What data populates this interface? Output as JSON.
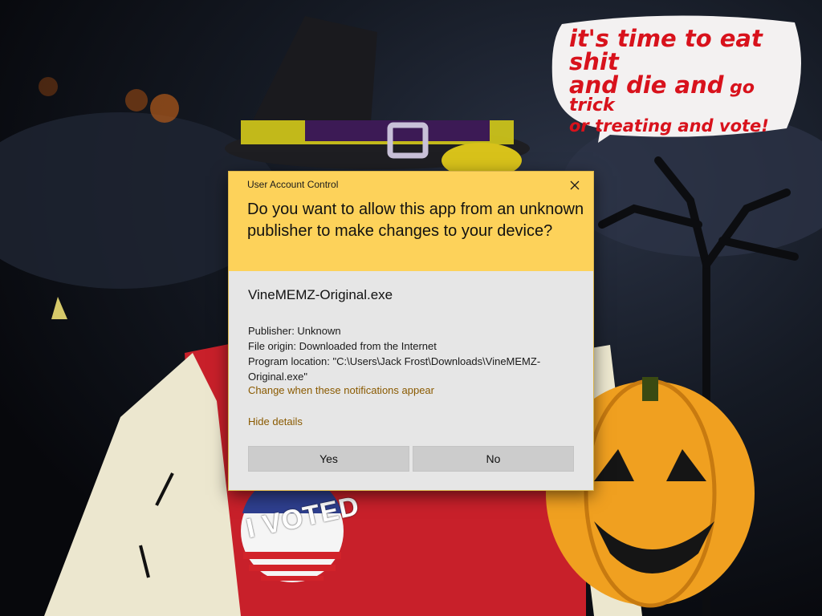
{
  "background": {
    "speech_bubble": {
      "line1": "it's time to eat shit",
      "line2_big": "and die and",
      "line2_small": " go trick",
      "line3": "or treating and vote!"
    },
    "sticker_text": "I VOTED",
    "colors": {
      "speech_text": "#d8121c",
      "pumpkin": "#f0a020",
      "shirt": "#c8202a"
    }
  },
  "dialog": {
    "title": "User Account Control",
    "close_icon": "close-icon",
    "question": "Do you want to allow this app from an unknown publisher to make changes to your device?",
    "app_name": "VineMEMZ-Original.exe",
    "publisher": "Publisher: Unknown",
    "file_origin": "File origin: Downloaded from the Internet",
    "program_location": "Program location: \"C:\\Users\\Jack Frost\\Downloads\\VineMEMZ-Original.exe\"",
    "change_link": "Change when these notifications appear",
    "hide_details_link": "Hide details",
    "yes_label": "Yes",
    "no_label": "No",
    "colors": {
      "header": "#fdd25a",
      "body": "#e6e6e6",
      "link": "#8a5a00",
      "button": "#cccccc"
    }
  }
}
